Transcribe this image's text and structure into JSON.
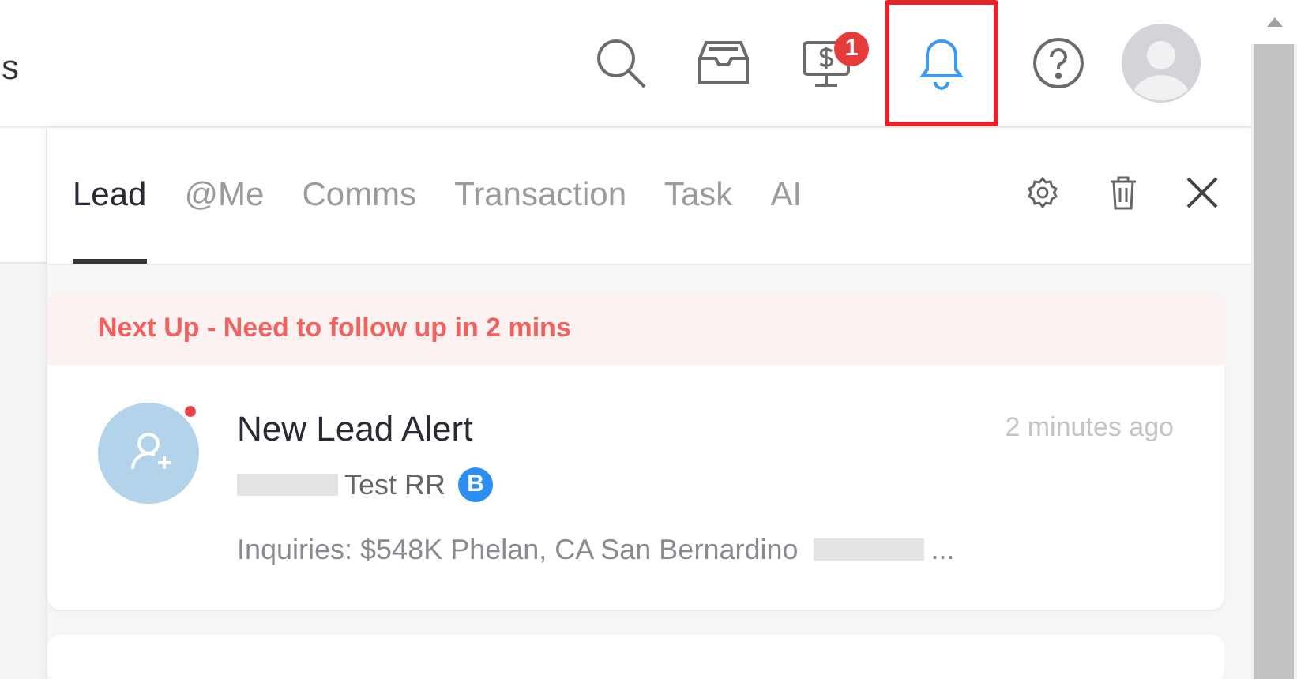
{
  "header": {
    "cut_title": "s",
    "icons": [
      {
        "kind": "search",
        "highlighted": false
      },
      {
        "kind": "inbox",
        "highlighted": false
      },
      {
        "kind": "monitor",
        "highlighted": false,
        "badge": "1"
      },
      {
        "kind": "bell",
        "highlighted": true
      },
      {
        "kind": "help",
        "highlighted": false
      },
      {
        "kind": "avatar",
        "highlighted": false
      }
    ]
  },
  "panel": {
    "tabs": [
      {
        "label": "Lead",
        "selected": true
      },
      {
        "label": "@Me",
        "selected": false
      },
      {
        "label": "Comms",
        "selected": false
      },
      {
        "label": "Transaction",
        "selected": false
      },
      {
        "label": "Task",
        "selected": false
      },
      {
        "label": "AI",
        "selected": false
      }
    ],
    "banner": "Next Up - Need to follow up in 2 mins",
    "notifications": [
      {
        "title": "New Lead Alert",
        "time": "2 minutes ago",
        "unread": true,
        "name": "Test RR",
        "tag": "B",
        "detail": "Inquiries: $548K Phelan, CA San Bernardino",
        "detail_end": "..."
      }
    ]
  }
}
